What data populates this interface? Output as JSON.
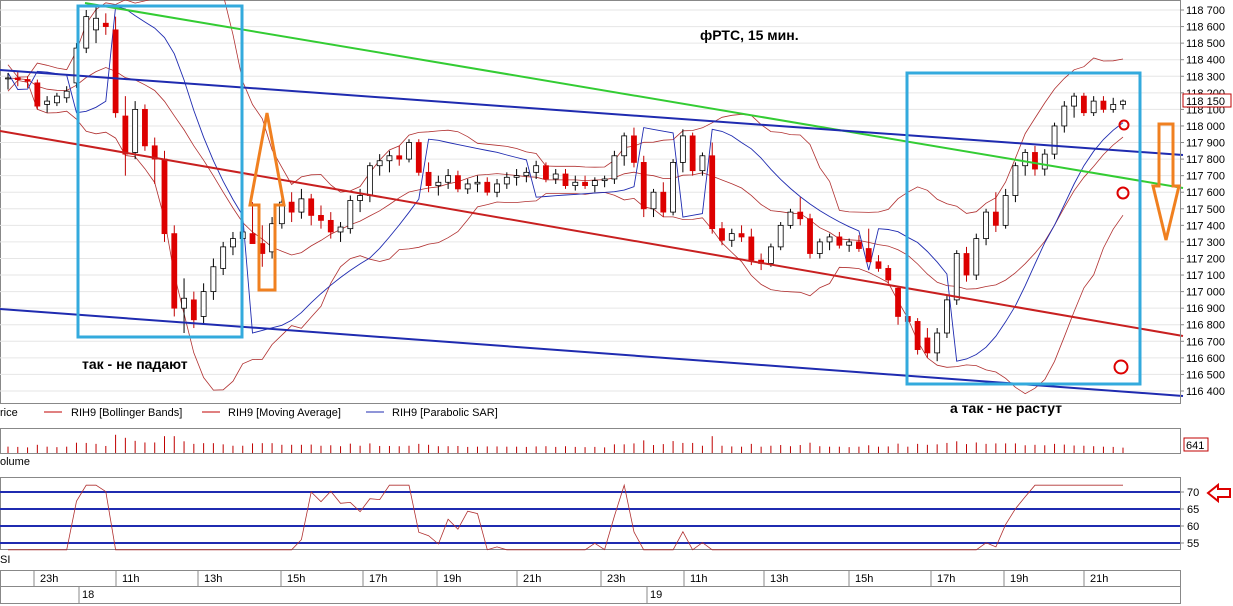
{
  "chart_data": {
    "type": "candlestick",
    "title": "фРТС,  15 мин.",
    "price_axis": {
      "ylim": [
        116350,
        118740
      ],
      "ticks": [
        118700,
        118600,
        118500,
        118400,
        118300,
        118200,
        118100,
        118000,
        117900,
        117800,
        117700,
        117600,
        117500,
        117400,
        117300,
        117200,
        117100,
        117000,
        116900,
        116800,
        116700,
        116600,
        116500,
        116400
      ],
      "tick_labels": [
        "118 700",
        "118 600",
        "118 500",
        "118 400",
        "118 300",
        "118 200",
        "118 100",
        "118 000",
        "117 900",
        "117 800",
        "117 700",
        "117 600",
        "117 500",
        "117 400",
        "117 300",
        "117 200",
        "117 100",
        "117 000",
        "116 900",
        "116 800",
        "116 700",
        "116 600",
        "116 500",
        "116 400"
      ],
      "last_price_label": "118 150",
      "last_price": 118150
    },
    "time_axis": {
      "labels": [
        "23h",
        "11h",
        "13h",
        "15h",
        "17h",
        "19h",
        "21h",
        "23h",
        "11h",
        "13h",
        "15h",
        "17h",
        "19h",
        "21h"
      ],
      "dates": [
        "18",
        "19"
      ]
    },
    "candles": [
      {
        "o": 118290,
        "h": 118320,
        "l": 118220,
        "c": 118290
      },
      {
        "o": 118290,
        "h": 118330,
        "l": 118240,
        "c": 118280
      },
      {
        "o": 118280,
        "h": 118300,
        "l": 118230,
        "c": 118270
      },
      {
        "o": 118260,
        "h": 118280,
        "l": 118100,
        "c": 118120
      },
      {
        "o": 118130,
        "h": 118180,
        "l": 118080,
        "c": 118150
      },
      {
        "o": 118140,
        "h": 118200,
        "l": 118120,
        "c": 118180
      },
      {
        "o": 118170,
        "h": 118240,
        "l": 118140,
        "c": 118210
      },
      {
        "o": 118260,
        "h": 118500,
        "l": 118230,
        "c": 118470
      },
      {
        "o": 118470,
        "h": 118700,
        "l": 118440,
        "c": 118660
      },
      {
        "o": 118580,
        "h": 118720,
        "l": 118500,
        "c": 118650
      },
      {
        "o": 118620,
        "h": 118680,
        "l": 118550,
        "c": 118600
      },
      {
        "o": 118580,
        "h": 118660,
        "l": 118050,
        "c": 118080
      },
      {
        "o": 118060,
        "h": 118180,
        "l": 117700,
        "c": 117830
      },
      {
        "o": 117840,
        "h": 118150,
        "l": 117800,
        "c": 118100
      },
      {
        "o": 118100,
        "h": 118130,
        "l": 117850,
        "c": 117880
      },
      {
        "o": 117880,
        "h": 117930,
        "l": 117650,
        "c": 117800
      },
      {
        "o": 117800,
        "h": 117850,
        "l": 117300,
        "c": 117350
      },
      {
        "o": 117350,
        "h": 117400,
        "l": 116850,
        "c": 116900
      },
      {
        "o": 116900,
        "h": 117080,
        "l": 116750,
        "c": 116960
      },
      {
        "o": 116950,
        "h": 117000,
        "l": 116780,
        "c": 116830
      },
      {
        "o": 116850,
        "h": 117050,
        "l": 116800,
        "c": 117000
      },
      {
        "o": 117000,
        "h": 117200,
        "l": 116950,
        "c": 117150
      },
      {
        "o": 117140,
        "h": 117300,
        "l": 117100,
        "c": 117270
      },
      {
        "o": 117270,
        "h": 117360,
        "l": 117220,
        "c": 117320
      },
      {
        "o": 117320,
        "h": 117420,
        "l": 117280,
        "c": 117360
      },
      {
        "o": 117350,
        "h": 117540,
        "l": 117300,
        "c": 117290
      },
      {
        "o": 117290,
        "h": 117400,
        "l": 117150,
        "c": 117230
      },
      {
        "o": 117240,
        "h": 117450,
        "l": 117200,
        "c": 117410
      },
      {
        "o": 117410,
        "h": 117560,
        "l": 117380,
        "c": 117540
      },
      {
        "o": 117540,
        "h": 117600,
        "l": 117420,
        "c": 117480
      },
      {
        "o": 117480,
        "h": 117620,
        "l": 117440,
        "c": 117560
      },
      {
        "o": 117560,
        "h": 117590,
        "l": 117400,
        "c": 117460
      },
      {
        "o": 117460,
        "h": 117520,
        "l": 117380,
        "c": 117430
      },
      {
        "o": 117430,
        "h": 117480,
        "l": 117320,
        "c": 117360
      },
      {
        "o": 117360,
        "h": 117420,
        "l": 117300,
        "c": 117390
      },
      {
        "o": 117380,
        "h": 117580,
        "l": 117350,
        "c": 117550
      },
      {
        "o": 117550,
        "h": 117620,
        "l": 117480,
        "c": 117580
      },
      {
        "o": 117580,
        "h": 117780,
        "l": 117540,
        "c": 117760
      },
      {
        "o": 117760,
        "h": 117830,
        "l": 117700,
        "c": 117790
      },
      {
        "o": 117790,
        "h": 117850,
        "l": 117720,
        "c": 117820
      },
      {
        "o": 117820,
        "h": 117880,
        "l": 117760,
        "c": 117800
      },
      {
        "o": 117800,
        "h": 117920,
        "l": 117780,
        "c": 117900
      },
      {
        "o": 117900,
        "h": 117920,
        "l": 117700,
        "c": 117720
      },
      {
        "o": 117720,
        "h": 117780,
        "l": 117600,
        "c": 117640
      },
      {
        "o": 117640,
        "h": 117700,
        "l": 117580,
        "c": 117660
      },
      {
        "o": 117660,
        "h": 117740,
        "l": 117620,
        "c": 117700
      },
      {
        "o": 117700,
        "h": 117730,
        "l": 117600,
        "c": 117620
      },
      {
        "o": 117620,
        "h": 117680,
        "l": 117590,
        "c": 117650
      },
      {
        "o": 117650,
        "h": 117700,
        "l": 117600,
        "c": 117660
      },
      {
        "o": 117660,
        "h": 117690,
        "l": 117580,
        "c": 117600
      },
      {
        "o": 117600,
        "h": 117680,
        "l": 117570,
        "c": 117650
      },
      {
        "o": 117650,
        "h": 117720,
        "l": 117620,
        "c": 117690
      },
      {
        "o": 117690,
        "h": 117740,
        "l": 117640,
        "c": 117700
      },
      {
        "o": 117700,
        "h": 117750,
        "l": 117660,
        "c": 117720
      },
      {
        "o": 117720,
        "h": 117790,
        "l": 117680,
        "c": 117760
      },
      {
        "o": 117760,
        "h": 117780,
        "l": 117660,
        "c": 117680
      },
      {
        "o": 117680,
        "h": 117740,
        "l": 117650,
        "c": 117710
      },
      {
        "o": 117710,
        "h": 117740,
        "l": 117620,
        "c": 117640
      },
      {
        "o": 117640,
        "h": 117700,
        "l": 117610,
        "c": 117660
      },
      {
        "o": 117660,
        "h": 117700,
        "l": 117620,
        "c": 117640
      },
      {
        "o": 117640,
        "h": 117690,
        "l": 117600,
        "c": 117670
      },
      {
        "o": 117670,
        "h": 117700,
        "l": 117630,
        "c": 117680
      },
      {
        "o": 117680,
        "h": 117850,
        "l": 117650,
        "c": 117820
      },
      {
        "o": 117820,
        "h": 117960,
        "l": 117760,
        "c": 117940
      },
      {
        "o": 117940,
        "h": 117990,
        "l": 117750,
        "c": 117780
      },
      {
        "o": 117780,
        "h": 117820,
        "l": 117450,
        "c": 117500
      },
      {
        "o": 117500,
        "h": 117620,
        "l": 117450,
        "c": 117600
      },
      {
        "o": 117600,
        "h": 117660,
        "l": 117450,
        "c": 117480
      },
      {
        "o": 117480,
        "h": 117800,
        "l": 117460,
        "c": 117780
      },
      {
        "o": 117780,
        "h": 117980,
        "l": 117720,
        "c": 117940
      },
      {
        "o": 117940,
        "h": 117960,
        "l": 117700,
        "c": 117730
      },
      {
        "o": 117730,
        "h": 117840,
        "l": 117700,
        "c": 117820
      },
      {
        "o": 117820,
        "h": 117900,
        "l": 117350,
        "c": 117380
      },
      {
        "o": 117380,
        "h": 117420,
        "l": 117280,
        "c": 117310
      },
      {
        "o": 117310,
        "h": 117380,
        "l": 117270,
        "c": 117350
      },
      {
        "o": 117350,
        "h": 117400,
        "l": 117300,
        "c": 117330
      },
      {
        "o": 117330,
        "h": 117380,
        "l": 117160,
        "c": 117190
      },
      {
        "o": 117190,
        "h": 117230,
        "l": 117130,
        "c": 117170
      },
      {
        "o": 117170,
        "h": 117290,
        "l": 117150,
        "c": 117270
      },
      {
        "o": 117270,
        "h": 117420,
        "l": 117250,
        "c": 117400
      },
      {
        "o": 117400,
        "h": 117500,
        "l": 117380,
        "c": 117480
      },
      {
        "o": 117480,
        "h": 117570,
        "l": 117400,
        "c": 117440
      },
      {
        "o": 117440,
        "h": 117470,
        "l": 117200,
        "c": 117230
      },
      {
        "o": 117230,
        "h": 117320,
        "l": 117200,
        "c": 117300
      },
      {
        "o": 117300,
        "h": 117350,
        "l": 117250,
        "c": 117330
      },
      {
        "o": 117330,
        "h": 117360,
        "l": 117260,
        "c": 117280
      },
      {
        "o": 117280,
        "h": 117320,
        "l": 117240,
        "c": 117300
      },
      {
        "o": 117300,
        "h": 117340,
        "l": 117240,
        "c": 117260
      },
      {
        "o": 117260,
        "h": 117380,
        "l": 117220,
        "c": 117180
      },
      {
        "o": 117180,
        "h": 117220,
        "l": 117120,
        "c": 117140
      },
      {
        "o": 117140,
        "h": 117160,
        "l": 117050,
        "c": 117070
      },
      {
        "o": 117020,
        "h": 117030,
        "l": 116800,
        "c": 116850
      },
      {
        "o": 116850,
        "h": 116900,
        "l": 116800,
        "c": 116820
      },
      {
        "o": 116820,
        "h": 116840,
        "l": 116620,
        "c": 116650
      },
      {
        "o": 116720,
        "h": 116780,
        "l": 116600,
        "c": 116630
      },
      {
        "o": 116630,
        "h": 116780,
        "l": 116580,
        "c": 116750
      },
      {
        "o": 116750,
        "h": 116980,
        "l": 116720,
        "c": 116950
      },
      {
        "o": 116950,
        "h": 117250,
        "l": 116920,
        "c": 117230
      },
      {
        "o": 117230,
        "h": 117270,
        "l": 117060,
        "c": 117100
      },
      {
        "o": 117100,
        "h": 117350,
        "l": 117070,
        "c": 117320
      },
      {
        "o": 117320,
        "h": 117500,
        "l": 117280,
        "c": 117480
      },
      {
        "o": 117480,
        "h": 117600,
        "l": 117360,
        "c": 117400
      },
      {
        "o": 117400,
        "h": 117620,
        "l": 117380,
        "c": 117580
      },
      {
        "o": 117580,
        "h": 117780,
        "l": 117540,
        "c": 117760
      },
      {
        "o": 117760,
        "h": 117860,
        "l": 117700,
        "c": 117840
      },
      {
        "o": 117840,
        "h": 117880,
        "l": 117700,
        "c": 117740
      },
      {
        "o": 117740,
        "h": 117860,
        "l": 117700,
        "c": 117830
      },
      {
        "o": 117830,
        "h": 118020,
        "l": 117800,
        "c": 118000
      },
      {
        "o": 118000,
        "h": 118150,
        "l": 117960,
        "c": 118120
      },
      {
        "o": 118120,
        "h": 118200,
        "l": 118050,
        "c": 118180
      },
      {
        "o": 118180,
        "h": 118200,
        "l": 118060,
        "c": 118080
      },
      {
        "o": 118080,
        "h": 118180,
        "l": 118060,
        "c": 118150
      },
      {
        "o": 118150,
        "h": 118180,
        "l": 118080,
        "c": 118100
      },
      {
        "o": 118100,
        "h": 118170,
        "l": 118080,
        "c": 118130
      },
      {
        "o": 118130,
        "h": 118160,
        "l": 118100,
        "c": 118150
      }
    ],
    "trend_lines": [
      {
        "name": "green",
        "color": "#33cc33",
        "from": [
          85,
          3
        ],
        "to": [
          1183,
          188
        ]
      },
      {
        "name": "blue-upper",
        "color": "#1f2bb0",
        "from": [
          0,
          70
        ],
        "to": [
          1183,
          155
        ]
      },
      {
        "name": "red",
        "color": "#c82020",
        "from": [
          0,
          131
        ],
        "to": [
          1183,
          336
        ]
      },
      {
        "name": "blue-lower",
        "color": "#1f2bb0",
        "from": [
          0,
          309
        ],
        "to": [
          1183,
          396
        ]
      }
    ],
    "legend": [
      {
        "label": "rice",
        "color": "#c00000"
      },
      {
        "label": "RIH9 [Bollinger Bands]",
        "color": "#c00000"
      },
      {
        "label": "RIH9 [Moving Average]",
        "color": "#c00000"
      },
      {
        "label": "RIH9 [Parabolic SAR]",
        "color": "#1f2bb0"
      }
    ],
    "volume_panel": {
      "label": "olume",
      "last_value": "641"
    },
    "rsi_panel": {
      "label": "SI",
      "ticks": [
        "70",
        "65",
        "60",
        "55"
      ],
      "levels": [
        70,
        65,
        60,
        55
      ]
    },
    "annotations": {
      "left": "так - не падают",
      "right": "а так - не растут"
    },
    "colors": {
      "bull": "#ffffff",
      "bear": "#dd0000",
      "box": "#33aadd",
      "arrow": "#f08020",
      "circle": "#dd0000"
    }
  }
}
